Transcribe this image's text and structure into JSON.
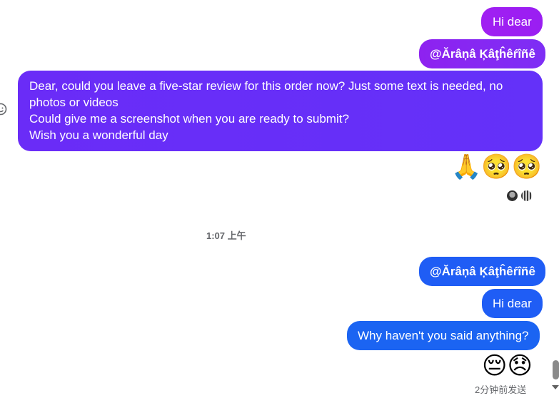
{
  "messages": {
    "m1": "Hi dear",
    "m2": "@Ărâņâ Ķâţĥêŕîñê",
    "m3_lines": [
      "Dear, could you leave a five-star review for this order now? Just some text is needed, no",
      "photos or videos",
      "Could give me a screenshot when you are ready to submit?",
      "Wish you a wonderful day"
    ],
    "m4": "@Ărâņâ Ķâţĥêŕîñê",
    "m5": "Hi dear",
    "m6": "Why haven't you said anything?"
  },
  "emoji_row_1": [
    "🙏",
    "🥺",
    "🥺"
  ],
  "emoji_row_2": [
    "😔",
    "😞"
  ],
  "timestamp": "1:07 上午",
  "sent_status": "2分钟前发送",
  "colors": {
    "purple": "#9a1ef2",
    "violet": "#6a2cf7",
    "blue": "#1f5df5"
  },
  "icons": {
    "react": "smiley-icon",
    "seen_1": "avatar",
    "seen_2": "avatar"
  }
}
